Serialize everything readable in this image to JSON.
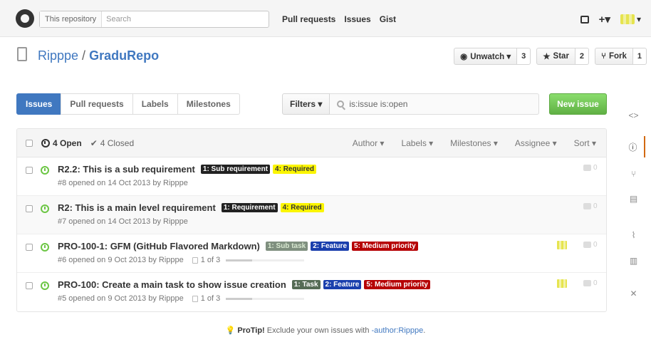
{
  "header": {
    "search_scope": "This repository",
    "search_placeholder": "Search",
    "nav": [
      "Pull requests",
      "Issues",
      "Gist"
    ],
    "plus_glyph": "+▾",
    "avatar_caret": "▾"
  },
  "repo": {
    "owner": "Ripppe",
    "separator": " / ",
    "name": "GraduRepo",
    "unwatch_label": "Unwatch ▾",
    "unwatch_count": "3",
    "star_label": "Star",
    "star_count": "2",
    "fork_label": "Fork",
    "fork_count": "1"
  },
  "subnav": {
    "tabs": [
      "Issues",
      "Pull requests",
      "Labels",
      "Milestones"
    ],
    "filters_label": "Filters ▾",
    "filter_query": "is:issue is:open",
    "new_issue_label": "New issue"
  },
  "list": {
    "open_label": "4 Open",
    "closed_label": "4 Closed",
    "closed_glyph": "✔",
    "menus": [
      "Author ▾",
      "Labels ▾",
      "Milestones ▾",
      "Assignee ▾",
      "Sort ▾"
    ]
  },
  "issues": [
    {
      "title": "R2.2: This is a sub requirement",
      "labels": [
        {
          "text": "1: Sub requirement",
          "color": "#222222",
          "fg": "#ffffff"
        },
        {
          "text": "4: Required",
          "color": "#fbf500",
          "fg": "#333333"
        }
      ],
      "meta": "#8 opened on 14 Oct 2013 by Ripppe",
      "tasks": "",
      "task_progress": null,
      "assigned": false,
      "comments": "0"
    },
    {
      "title": "R2: This is a main level requirement",
      "labels": [
        {
          "text": "1: Requirement",
          "color": "#222222",
          "fg": "#ffffff"
        },
        {
          "text": "4: Required",
          "color": "#fbf500",
          "fg": "#333333"
        }
      ],
      "meta": "#7 opened on 14 Oct 2013 by Ripppe",
      "tasks": "",
      "task_progress": null,
      "assigned": false,
      "comments": "0"
    },
    {
      "title": "PRO-100-1: GFM (GitHub Flavored Markdown)",
      "labels": [
        {
          "text": "1: Sub task",
          "color": "#7f8f7f",
          "fg": "#d8e8d0"
        },
        {
          "text": "2: Feature",
          "color": "#1a3fad",
          "fg": "#ffffff"
        },
        {
          "text": "5: Medium priority",
          "color": "#b60205",
          "fg": "#ffffff"
        }
      ],
      "meta": "#6 opened on 9 Oct 2013 by Ripppe",
      "tasks": "1 of 3",
      "task_progress": 0.33,
      "assigned": true,
      "comments": "0"
    },
    {
      "title": "PRO-100: Create a main task to show issue creation",
      "labels": [
        {
          "text": "1: Task",
          "color": "#556b55",
          "fg": "#ffffff"
        },
        {
          "text": "2: Feature",
          "color": "#1a3fad",
          "fg": "#ffffff"
        },
        {
          "text": "5: Medium priority",
          "color": "#b60205",
          "fg": "#ffffff"
        }
      ],
      "meta": "#5 opened on 9 Oct 2013 by Ripppe",
      "tasks": "1 of 3",
      "task_progress": 0.33,
      "assigned": true,
      "comments": "0"
    }
  ],
  "sidebar": {
    "items": [
      {
        "name": "code-icon",
        "glyph": "<>"
      },
      {
        "name": "issues-icon",
        "glyph": "ⓘ"
      },
      {
        "name": "pull-request-icon",
        "glyph": "⑂"
      },
      {
        "name": "wiki-icon",
        "glyph": "▤"
      },
      {
        "name": "pulse-icon",
        "glyph": "⌇"
      },
      {
        "name": "graphs-icon",
        "glyph": "▥"
      },
      {
        "name": "settings-icon",
        "glyph": "✕"
      }
    ],
    "selected_index": 1
  },
  "protip": {
    "lead": "ProTip!",
    "text": " Exclude your own issues with ",
    "link": "-author:Ripppe",
    "tail": "."
  }
}
